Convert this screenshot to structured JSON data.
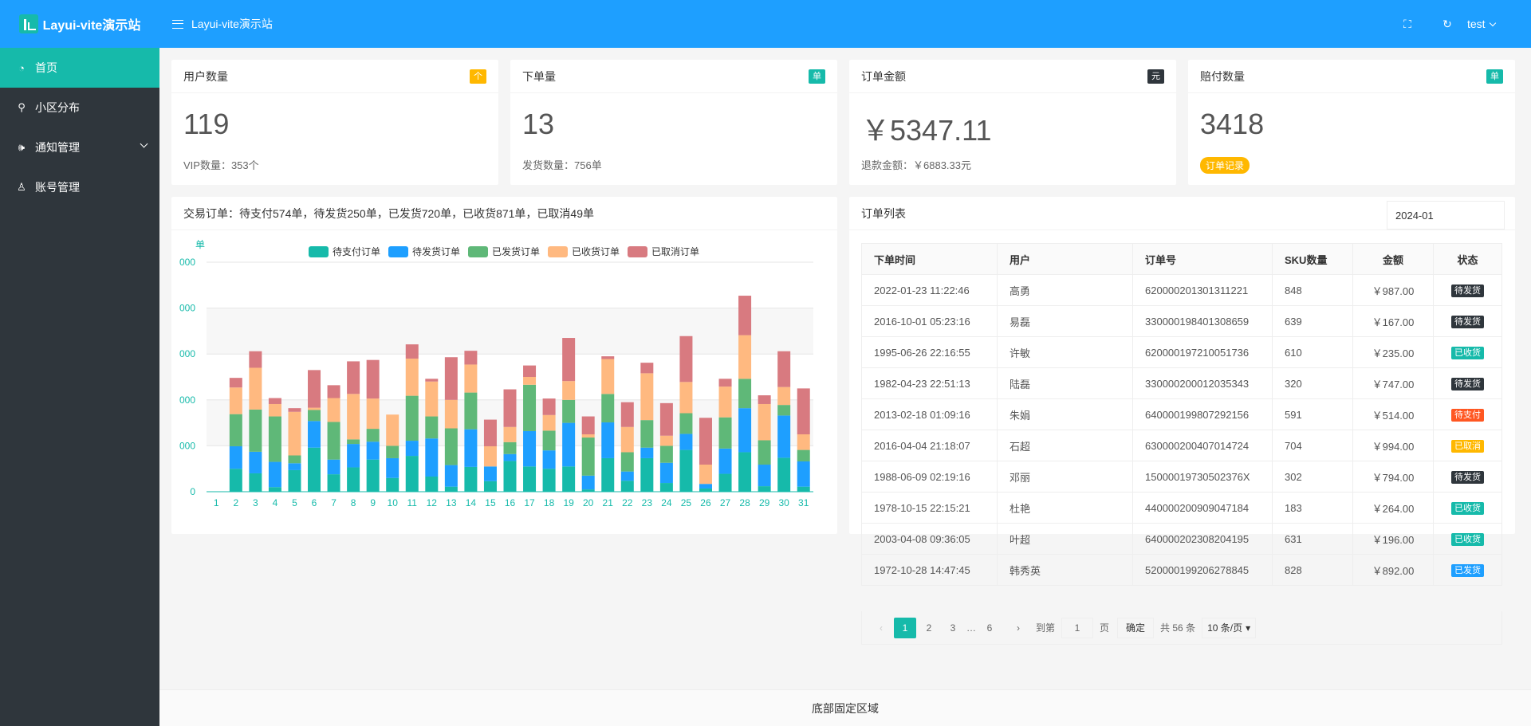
{
  "app": {
    "title": "Layui-vite演示站"
  },
  "sidebar": {
    "items": [
      {
        "label": "首页",
        "icon": "dashboard-icon",
        "active": true
      },
      {
        "label": "小区分布",
        "icon": "location-pin-icon"
      },
      {
        "label": "通知管理",
        "icon": "speaker-icon",
        "has_children": true
      },
      {
        "label": "账号管理",
        "icon": "user-icon"
      }
    ]
  },
  "header": {
    "title": "Layui-vite演示站",
    "user": "test",
    "icons": [
      "fullscreen-icon",
      "refresh-icon"
    ]
  },
  "stats": [
    {
      "title": "用户数量",
      "badge": "个",
      "badge_color": "#ffb800",
      "value": "119",
      "sub": "VIP数量：353个"
    },
    {
      "title": "下单量",
      "badge": "单",
      "badge_color": "#16baaa",
      "value": "13",
      "sub": "发货数量：756单"
    },
    {
      "title": "订单金额",
      "badge": "元",
      "badge_color": "#2f363c",
      "value": "￥5347.11",
      "sub": "退款金额：￥6883.33元"
    },
    {
      "title": "赔付数量",
      "badge": "单",
      "badge_color": "#16baaa",
      "value": "3418",
      "pill": "订单记录"
    }
  ],
  "chart_panel": {
    "title": "交易订单：待支付574单，待发货250单，已发货720单，已收货871单，已取消49单"
  },
  "chart_data": {
    "type": "bar",
    "stacked": true,
    "ylabel": "单",
    "y_tick_labels": [
      "0",
      "000",
      "000",
      "000",
      "000",
      "000"
    ],
    "categories": [
      "1",
      "2",
      "3",
      "4",
      "5",
      "6",
      "7",
      "8",
      "9",
      "10",
      "11",
      "12",
      "13",
      "14",
      "15",
      "16",
      "17",
      "18",
      "19",
      "20",
      "21",
      "22",
      "23",
      "24",
      "25",
      "26",
      "27",
      "28",
      "29",
      "30",
      "31"
    ],
    "legend_position": "top",
    "series": [
      {
        "name": "待支付订单",
        "color": "#16baaa",
        "values": [
          0,
          50,
          40,
          10,
          47,
          96,
          38,
          53,
          70,
          30,
          78,
          33,
          11,
          54,
          23,
          67,
          55,
          50,
          55,
          5,
          73,
          24,
          73,
          19,
          91,
          7,
          39,
          86,
          12,
          74,
          11
        ]
      },
      {
        "name": "待发货订单",
        "color": "#1e9fff",
        "values": [
          0,
          49,
          47,
          55,
          15,
          58,
          32,
          51,
          39,
          43,
          33,
          83,
          47,
          82,
          32,
          15,
          77,
          40,
          95,
          30,
          78,
          20,
          23,
          44,
          35,
          10,
          55,
          96,
          47,
          92,
          55
        ]
      },
      {
        "name": "已发货订单",
        "color": "#5fb878",
        "values": [
          0,
          70,
          92,
          99,
          17,
          24,
          82,
          10,
          28,
          27,
          98,
          48,
          80,
          80,
          0,
          26,
          101,
          43,
          50,
          83,
          62,
          42,
          60,
          37,
          45,
          0,
          68,
          64,
          53,
          23,
          25
        ]
      },
      {
        "name": "已收货订单",
        "color": "#ffb980",
        "values": [
          0,
          58,
          91,
          27,
          95,
          5,
          52,
          99,
          66,
          68,
          81,
          76,
          62,
          61,
          44,
          33,
          17,
          34,
          41,
          7,
          76,
          55,
          102,
          22,
          68,
          42,
          67,
          95,
          79,
          39,
          34
        ]
      },
      {
        "name": "已取消订单",
        "color": "#d87a80",
        "values": [
          0,
          21,
          36,
          13,
          8,
          82,
          28,
          71,
          84,
          0,
          31,
          6,
          93,
          30,
          58,
          82,
          25,
          36,
          94,
          39,
          6,
          54,
          23,
          71,
          100,
          102,
          17,
          86,
          19,
          78,
          100
        ]
      }
    ]
  },
  "orders": {
    "title": "订单列表",
    "date": "2024-01",
    "columns": [
      "下单时间",
      "用户",
      "订单号",
      "SKU数量",
      "金额",
      "状态"
    ],
    "rows": [
      {
        "time": "2022-01-23 11:22:46",
        "user": "高勇",
        "no": "620000201301311221",
        "sku": "848",
        "amount": "￥987.00",
        "status": "待发货",
        "color": "#2f363c"
      },
      {
        "time": "2016-10-01 05:23:16",
        "user": "易磊",
        "no": "330000198401308659",
        "sku": "639",
        "amount": "￥167.00",
        "status": "待发货",
        "color": "#2f363c"
      },
      {
        "time": "1995-06-26 22:16:55",
        "user": "许敏",
        "no": "620000197210051736",
        "sku": "610",
        "amount": "￥235.00",
        "status": "已收货",
        "color": "#16baaa"
      },
      {
        "time": "1982-04-23 22:51:13",
        "user": "陆磊",
        "no": "330000200012035343",
        "sku": "320",
        "amount": "￥747.00",
        "status": "待发货",
        "color": "#2f363c"
      },
      {
        "time": "2013-02-18 01:09:16",
        "user": "朱娟",
        "no": "640000199807292156",
        "sku": "591",
        "amount": "￥514.00",
        "status": "待支付",
        "color": "#ff5722"
      },
      {
        "time": "2016-04-04 21:18:07",
        "user": "石超",
        "no": "630000200407014724",
        "sku": "704",
        "amount": "￥994.00",
        "status": "已取消",
        "color": "#ffb800"
      },
      {
        "time": "1988-06-09 02:19:16",
        "user": "邓丽",
        "no": "15000019730502376X",
        "sku": "302",
        "amount": "￥794.00",
        "status": "待发货",
        "color": "#2f363c"
      },
      {
        "time": "1978-10-15 22:15:21",
        "user": "杜艳",
        "no": "440000200909047184",
        "sku": "183",
        "amount": "￥264.00",
        "status": "已收货",
        "color": "#16baaa"
      },
      {
        "time": "2003-04-08 09:36:05",
        "user": "叶超",
        "no": "640000202308204195",
        "sku": "631",
        "amount": "￥196.00",
        "status": "已收货",
        "color": "#16baaa"
      },
      {
        "time": "1972-10-28 14:47:45",
        "user": "韩秀英",
        "no": "520000199206278845",
        "sku": "828",
        "amount": "￥892.00",
        "status": "已发货",
        "color": "#1e9fff"
      }
    ],
    "pager": {
      "pages": [
        "1",
        "2",
        "3",
        "…",
        "6"
      ],
      "current": "1",
      "goto": "到第",
      "goto_value": "1",
      "page_unit": "页",
      "confirm": "确定",
      "total": "共 56 条",
      "per_page": "10 条/页"
    }
  },
  "footer": {
    "text": "底部固定区域"
  }
}
